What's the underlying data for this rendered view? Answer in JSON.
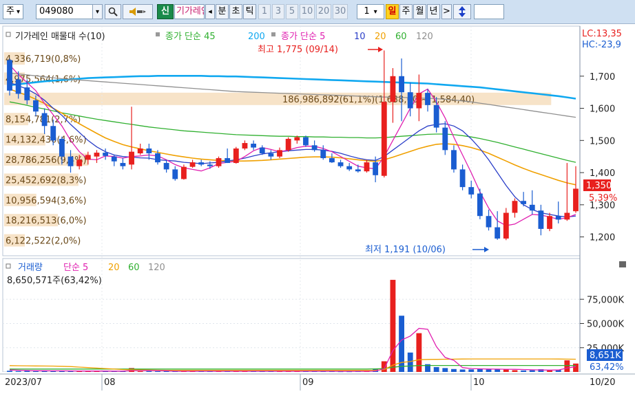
{
  "toolbar": {
    "market": "주",
    "market_caret": "▾",
    "code": "049080",
    "code_caret": "▾",
    "search_icon": "magnifier-icon",
    "sound_icon": "speaker-icon",
    "new_button": "신",
    "name_field": "기가레인",
    "scroll_left": "◂",
    "unit_buttons": [
      "분",
      "초",
      "틱"
    ],
    "interval_buttons": [
      "1",
      "3",
      "5",
      "10",
      "20",
      "30"
    ],
    "period_value": "1",
    "period_caret": "▾",
    "period_buttons": [
      "일",
      "주",
      "월",
      "년"
    ],
    "scroll_right": ">",
    "updown_icon": "updown-arrow-icon"
  },
  "colors": {
    "up": "#e8201e",
    "down": "#1a5dd1",
    "ma5": "#e020b0",
    "ma10": "#2a3ec8",
    "ma20": "#f0a000",
    "ma60": "#30b030",
    "ma120": "#909090",
    "ma200": "#10a8f0",
    "accent": "#cfe0f2"
  },
  "price_panel": {
    "legend": {
      "title": "기가레인 매물대 수(10)",
      "sma_label": "종가 단순 45",
      "sma_value": "200",
      "sma2_label": "종가 단순 5",
      "ma_periods": [
        "10",
        "20",
        "60",
        "120"
      ]
    },
    "lc_label": "LC:13,35",
    "hc_label": "HC:-23,9",
    "last_price": "1,350",
    "last_change": "5,39%",
    "high_label": "최고 1,775 (09/14)",
    "low_label": "최저 1,191 (10/06)",
    "volume_profile_labels": [
      "4,336,719(0,8%)",
      "4,975,564(1,6%)",
      "186,986,892(61,1%)(1,638,60 ~ 1,584,40)",
      "8,154,781(2,7%)",
      "14,132,430(4,6%)",
      "28,786,256(9,4%)",
      "25,452,692(8,3%)",
      "10,956,594(3,6%)",
      "18,216,513(6,0%)",
      "6,122,522(2,0%)"
    ],
    "profile_fraction": [
      0.008,
      0.016,
      0.611,
      0.027,
      0.046,
      0.094,
      0.083,
      0.036,
      0.06,
      0.02
    ]
  },
  "volume_panel": {
    "legend": {
      "title": "거래량",
      "sma_label": "단순 5",
      "ma_periods": [
        "20",
        "60",
        "120"
      ]
    },
    "current": "8,650,571주(63,42%)",
    "last_volume": "8,651K",
    "last_ratio": "63,42%"
  },
  "x_axis": {
    "labels": [
      "2023/07",
      "08",
      "09",
      "10"
    ],
    "end_label": "10/20"
  },
  "chart_data": [
    {
      "type": "candlestick",
      "ylim": [
        1150,
        1800
      ],
      "y_ticks": [
        1200,
        1300,
        1400,
        1500,
        1600,
        1700
      ],
      "y_tick_labels": [
        "1,200",
        "1,300",
        "1,400",
        "1,500",
        "1,600",
        "1,700"
      ],
      "x_labels": [
        "2023/07",
        "08",
        "09",
        "10"
      ],
      "ohlc": [
        [
          1750,
          1755,
          1640,
          1655
        ],
        [
          1690,
          1715,
          1630,
          1645
        ],
        [
          1665,
          1690,
          1612,
          1625
        ],
        [
          1625,
          1640,
          1575,
          1590
        ],
        [
          1585,
          1600,
          1520,
          1545
        ],
        [
          1545,
          1565,
          1485,
          1500
        ],
        [
          1505,
          1512,
          1425,
          1450
        ],
        [
          1450,
          1470,
          1400,
          1420
        ],
        [
          1420,
          1455,
          1410,
          1440
        ],
        [
          1440,
          1465,
          1425,
          1455
        ],
        [
          1450,
          1470,
          1430,
          1462
        ],
        [
          1462,
          1475,
          1440,
          1452
        ],
        [
          1450,
          1455,
          1420,
          1435
        ],
        [
          1430,
          1445,
          1410,
          1420
        ],
        [
          1425,
          1605,
          1410,
          1465
        ],
        [
          1460,
          1490,
          1455,
          1475
        ],
        [
          1475,
          1490,
          1440,
          1460
        ],
        [
          1460,
          1470,
          1425,
          1432
        ],
        [
          1430,
          1440,
          1400,
          1410
        ],
        [
          1410,
          1420,
          1375,
          1380
        ],
        [
          1380,
          1425,
          1378,
          1418
        ],
        [
          1418,
          1440,
          1415,
          1432
        ],
        [
          1432,
          1440,
          1420,
          1425
        ],
        [
          1425,
          1435,
          1412,
          1420
        ],
        [
          1420,
          1450,
          1415,
          1445
        ],
        [
          1445,
          1475,
          1430,
          1430
        ],
        [
          1430,
          1480,
          1428,
          1475
        ],
        [
          1475,
          1500,
          1470,
          1492
        ],
        [
          1490,
          1500,
          1470,
          1478
        ],
        [
          1478,
          1485,
          1455,
          1460
        ],
        [
          1460,
          1470,
          1440,
          1450
        ],
        [
          1450,
          1478,
          1445,
          1470
        ],
        [
          1470,
          1510,
          1465,
          1505
        ],
        [
          1500,
          1515,
          1490,
          1510
        ],
        [
          1510,
          1515,
          1480,
          1485
        ],
        [
          1485,
          1500,
          1465,
          1470
        ],
        [
          1470,
          1485,
          1440,
          1445
        ],
        [
          1445,
          1460,
          1430,
          1432
        ],
        [
          1432,
          1440,
          1415,
          1420
        ],
        [
          1420,
          1430,
          1405,
          1410
        ],
        [
          1410,
          1425,
          1400,
          1404
        ],
        [
          1404,
          1440,
          1400,
          1432
        ],
        [
          1432,
          1450,
          1370,
          1392
        ],
        [
          1390,
          1780,
          1385,
          1620
        ],
        [
          1620,
          1725,
          1555,
          1700
        ],
        [
          1700,
          1755,
          1560,
          1650
        ],
        [
          1650,
          1680,
          1575,
          1600
        ],
        [
          1600,
          1705,
          1560,
          1648
        ],
        [
          1648,
          1660,
          1590,
          1610
        ],
        [
          1610,
          1635,
          1525,
          1540
        ],
        [
          1540,
          1560,
          1455,
          1470
        ],
        [
          1470,
          1485,
          1400,
          1410
        ],
        [
          1410,
          1425,
          1345,
          1355
        ],
        [
          1355,
          1375,
          1320,
          1332
        ],
        [
          1335,
          1350,
          1255,
          1265
        ],
        [
          1265,
          1285,
          1220,
          1230
        ],
        [
          1230,
          1280,
          1191,
          1195
        ],
        [
          1195,
          1290,
          1190,
          1275
        ],
        [
          1275,
          1320,
          1260,
          1312
        ],
        [
          1312,
          1340,
          1295,
          1302
        ],
        [
          1300,
          1345,
          1270,
          1282
        ],
        [
          1282,
          1300,
          1205,
          1225
        ],
        [
          1225,
          1275,
          1218,
          1265
        ],
        [
          1265,
          1310,
          1242,
          1254
        ],
        [
          1254,
          1430,
          1250,
          1275
        ],
        [
          1280,
          1420,
          1275,
          1350
        ]
      ],
      "moving_averages": {
        "ma5": [
          1735,
          1705,
          1680,
          1655,
          1615,
          1580,
          1545,
          1500,
          1465,
          1442,
          1440,
          1452,
          1450,
          1445,
          1450,
          1452,
          1455,
          1452,
          1440,
          1425,
          1415,
          1410,
          1405,
          1415,
          1428,
          1432,
          1435,
          1450,
          1468,
          1478,
          1472,
          1465,
          1470,
          1478,
          1482,
          1482,
          1475,
          1465,
          1450,
          1435,
          1420,
          1415,
          1412,
          1450,
          1500,
          1550,
          1600,
          1645,
          1660,
          1620,
          1570,
          1510,
          1455,
          1400,
          1340,
          1290,
          1250,
          1235,
          1240,
          1255,
          1270,
          1268,
          1262,
          1255,
          1260,
          1270
        ],
        "ma10": [
          1680,
          1670,
          1660,
          1645,
          1625,
          1600,
          1578,
          1550,
          1525,
          1500,
          1480,
          1465,
          1455,
          1450,
          1448,
          1446,
          1445,
          1440,
          1438,
          1436,
          1432,
          1430,
          1428,
          1430,
          1432,
          1436,
          1440,
          1445,
          1452,
          1458,
          1462,
          1465,
          1468,
          1470,
          1472,
          1472,
          1470,
          1466,
          1460,
          1452,
          1445,
          1440,
          1438,
          1450,
          1470,
          1490,
          1510,
          1530,
          1545,
          1550,
          1552,
          1545,
          1530,
          1505,
          1475,
          1440,
          1400,
          1360,
          1325,
          1300,
          1285,
          1275,
          1270,
          1265,
          1262,
          1265
        ],
        "ma20": [
          1660,
          1650,
          1640,
          1628,
          1615,
          1600,
          1585,
          1568,
          1552,
          1537,
          1522,
          1508,
          1497,
          1487,
          1480,
          1474,
          1468,
          1463,
          1458,
          1453,
          1449,
          1445,
          1442,
          1440,
          1438,
          1437,
          1436,
          1436,
          1437,
          1438,
          1440,
          1442,
          1444,
          1446,
          1448,
          1449,
          1449,
          1448,
          1446,
          1443,
          1440,
          1437,
          1435,
          1440,
          1448,
          1457,
          1466,
          1475,
          1482,
          1488,
          1490,
          1488,
          1484,
          1478,
          1470,
          1460,
          1448,
          1436,
          1424,
          1413,
          1403,
          1394,
          1385,
          1376,
          1368,
          1362
        ],
        "ma60": [
          1620,
          1615,
          1609,
          1603,
          1598,
          1592,
          1586,
          1581,
          1576,
          1571,
          1566,
          1562,
          1558,
          1554,
          1550,
          1546,
          1542,
          1539,
          1536,
          1533,
          1530,
          1528,
          1526,
          1524,
          1522,
          1520,
          1518,
          1517,
          1516,
          1515,
          1514,
          1513,
          1513,
          1512,
          1512,
          1511,
          1511,
          1510,
          1510,
          1509,
          1509,
          1508,
          1508,
          1509,
          1511,
          1513,
          1515,
          1517,
          1519,
          1520,
          1520,
          1518,
          1515,
          1511,
          1506,
          1500,
          1494,
          1487,
          1480,
          1473,
          1466,
          1459,
          1452,
          1445,
          1438,
          1432
        ],
        "ma120": [
          1710,
          1707,
          1704,
          1701,
          1698,
          1695,
          1692,
          1690,
          1688,
          1686,
          1684,
          1682,
          1680,
          1678,
          1676,
          1674,
          1672,
          1670,
          1668,
          1666,
          1664,
          1662,
          1660,
          1658,
          1656,
          1654,
          1652,
          1651,
          1650,
          1649,
          1648,
          1647,
          1646,
          1645,
          1644,
          1643,
          1642,
          1641,
          1640,
          1639,
          1638,
          1637,
          1636,
          1635,
          1635,
          1634,
          1633,
          1632,
          1631,
          1630,
          1628,
          1626,
          1623,
          1620,
          1616,
          1612,
          1608,
          1604,
          1600,
          1596,
          1592,
          1588,
          1584,
          1580,
          1576,
          1572
        ],
        "ma200": [
          1672,
          1675,
          1678,
          1681,
          1684,
          1686,
          1688,
          1690,
          1692,
          1694,
          1695,
          1696,
          1697,
          1698,
          1699,
          1700,
          1700,
          1701,
          1701,
          1701,
          1701,
          1701,
          1701,
          1700,
          1700,
          1699,
          1699,
          1698,
          1697,
          1696,
          1695,
          1694,
          1693,
          1692,
          1691,
          1690,
          1689,
          1688,
          1687,
          1686,
          1685,
          1684,
          1683,
          1682,
          1681,
          1680,
          1679,
          1678,
          1677,
          1675,
          1673,
          1671,
          1669,
          1667,
          1665,
          1662,
          1659,
          1656,
          1653,
          1650,
          1647,
          1644,
          1641,
          1638,
          1634,
          1630
        ]
      }
    },
    {
      "type": "bar",
      "ylim": [
        0,
        100000
      ],
      "y_ticks": [
        25000,
        50000,
        75000
      ],
      "y_tick_labels": [
        "25,000K",
        "50,000K",
        "75,000K"
      ],
      "values": [
        1200,
        900,
        1100,
        800,
        1500,
        1300,
        900,
        1000,
        700,
        800,
        900,
        800,
        900,
        700,
        4000,
        800,
        900,
        700,
        800,
        700,
        900,
        900,
        800,
        700,
        900,
        800,
        900,
        900,
        800,
        700,
        800,
        700,
        900,
        900,
        800,
        800,
        700,
        700,
        600,
        600,
        700,
        800,
        3000,
        11000,
        95000,
        58000,
        20000,
        40000,
        8000,
        5000,
        4000,
        3000,
        2500,
        2600,
        3500,
        2500,
        3200,
        2700,
        1800,
        1500,
        1700,
        2800,
        1700,
        2400,
        12000,
        8651
      ],
      "ma5": [
        2000,
        1800,
        1500,
        1300,
        1200,
        1150,
        1100,
        1050,
        1000,
        950,
        900,
        900,
        880,
        860,
        1400,
        1450,
        1500,
        1300,
        1200,
        800,
        780,
        780,
        780,
        780,
        780,
        780,
        780,
        780,
        780,
        780,
        780,
        780,
        780,
        780,
        780,
        780,
        780,
        760,
        740,
        720,
        700,
        700,
        1000,
        3200,
        22000,
        33000,
        37000,
        45000,
        44000,
        26000,
        15000,
        12000,
        4500,
        3500,
        3200,
        3000,
        2900,
        2800,
        2700,
        2500,
        2200,
        2000,
        1900,
        2000,
        4000,
        5500
      ],
      "ma20": [
        6500,
        6400,
        6300,
        6200,
        6100,
        6000,
        5800,
        5500,
        5000,
        4500,
        4000,
        3500,
        3000,
        2500,
        2200,
        2000,
        1900,
        1800,
        1700,
        1600,
        1600,
        1600,
        1600,
        1600,
        1600,
        1600,
        1600,
        1600,
        1600,
        1600,
        1600,
        1600,
        1600,
        1600,
        1600,
        1600,
        1600,
        1600,
        1600,
        1600,
        1600,
        1600,
        1800,
        2400,
        7000,
        9800,
        10700,
        12600,
        12900,
        13000,
        13100,
        13200,
        13300,
        13400,
        13400,
        13400,
        13400,
        13400,
        13400,
        13400,
        13400,
        13400,
        13400,
        13300,
        13200,
        13100
      ],
      "ma60": [
        3000,
        3000,
        3000,
        3000,
        3000,
        3000,
        3000,
        3000,
        3000,
        3000,
        3000,
        3000,
        3000,
        3000,
        3000,
        3000,
        3000,
        3000,
        3000,
        3000,
        3000,
        3000,
        3000,
        3000,
        3000,
        3000,
        3000,
        3000,
        3000,
        3000,
        3000,
        3000,
        3000,
        3000,
        3000,
        3000,
        3000,
        3000,
        3000,
        3000,
        3000,
        3000,
        3200,
        3400,
        4800,
        5800,
        6100,
        6600,
        6700,
        6700,
        6700,
        6700,
        6700,
        6700,
        6700,
        6700,
        6700,
        6700,
        6700,
        6700,
        6700,
        6700,
        6700,
        6700,
        6700,
        6700
      ]
    }
  ]
}
